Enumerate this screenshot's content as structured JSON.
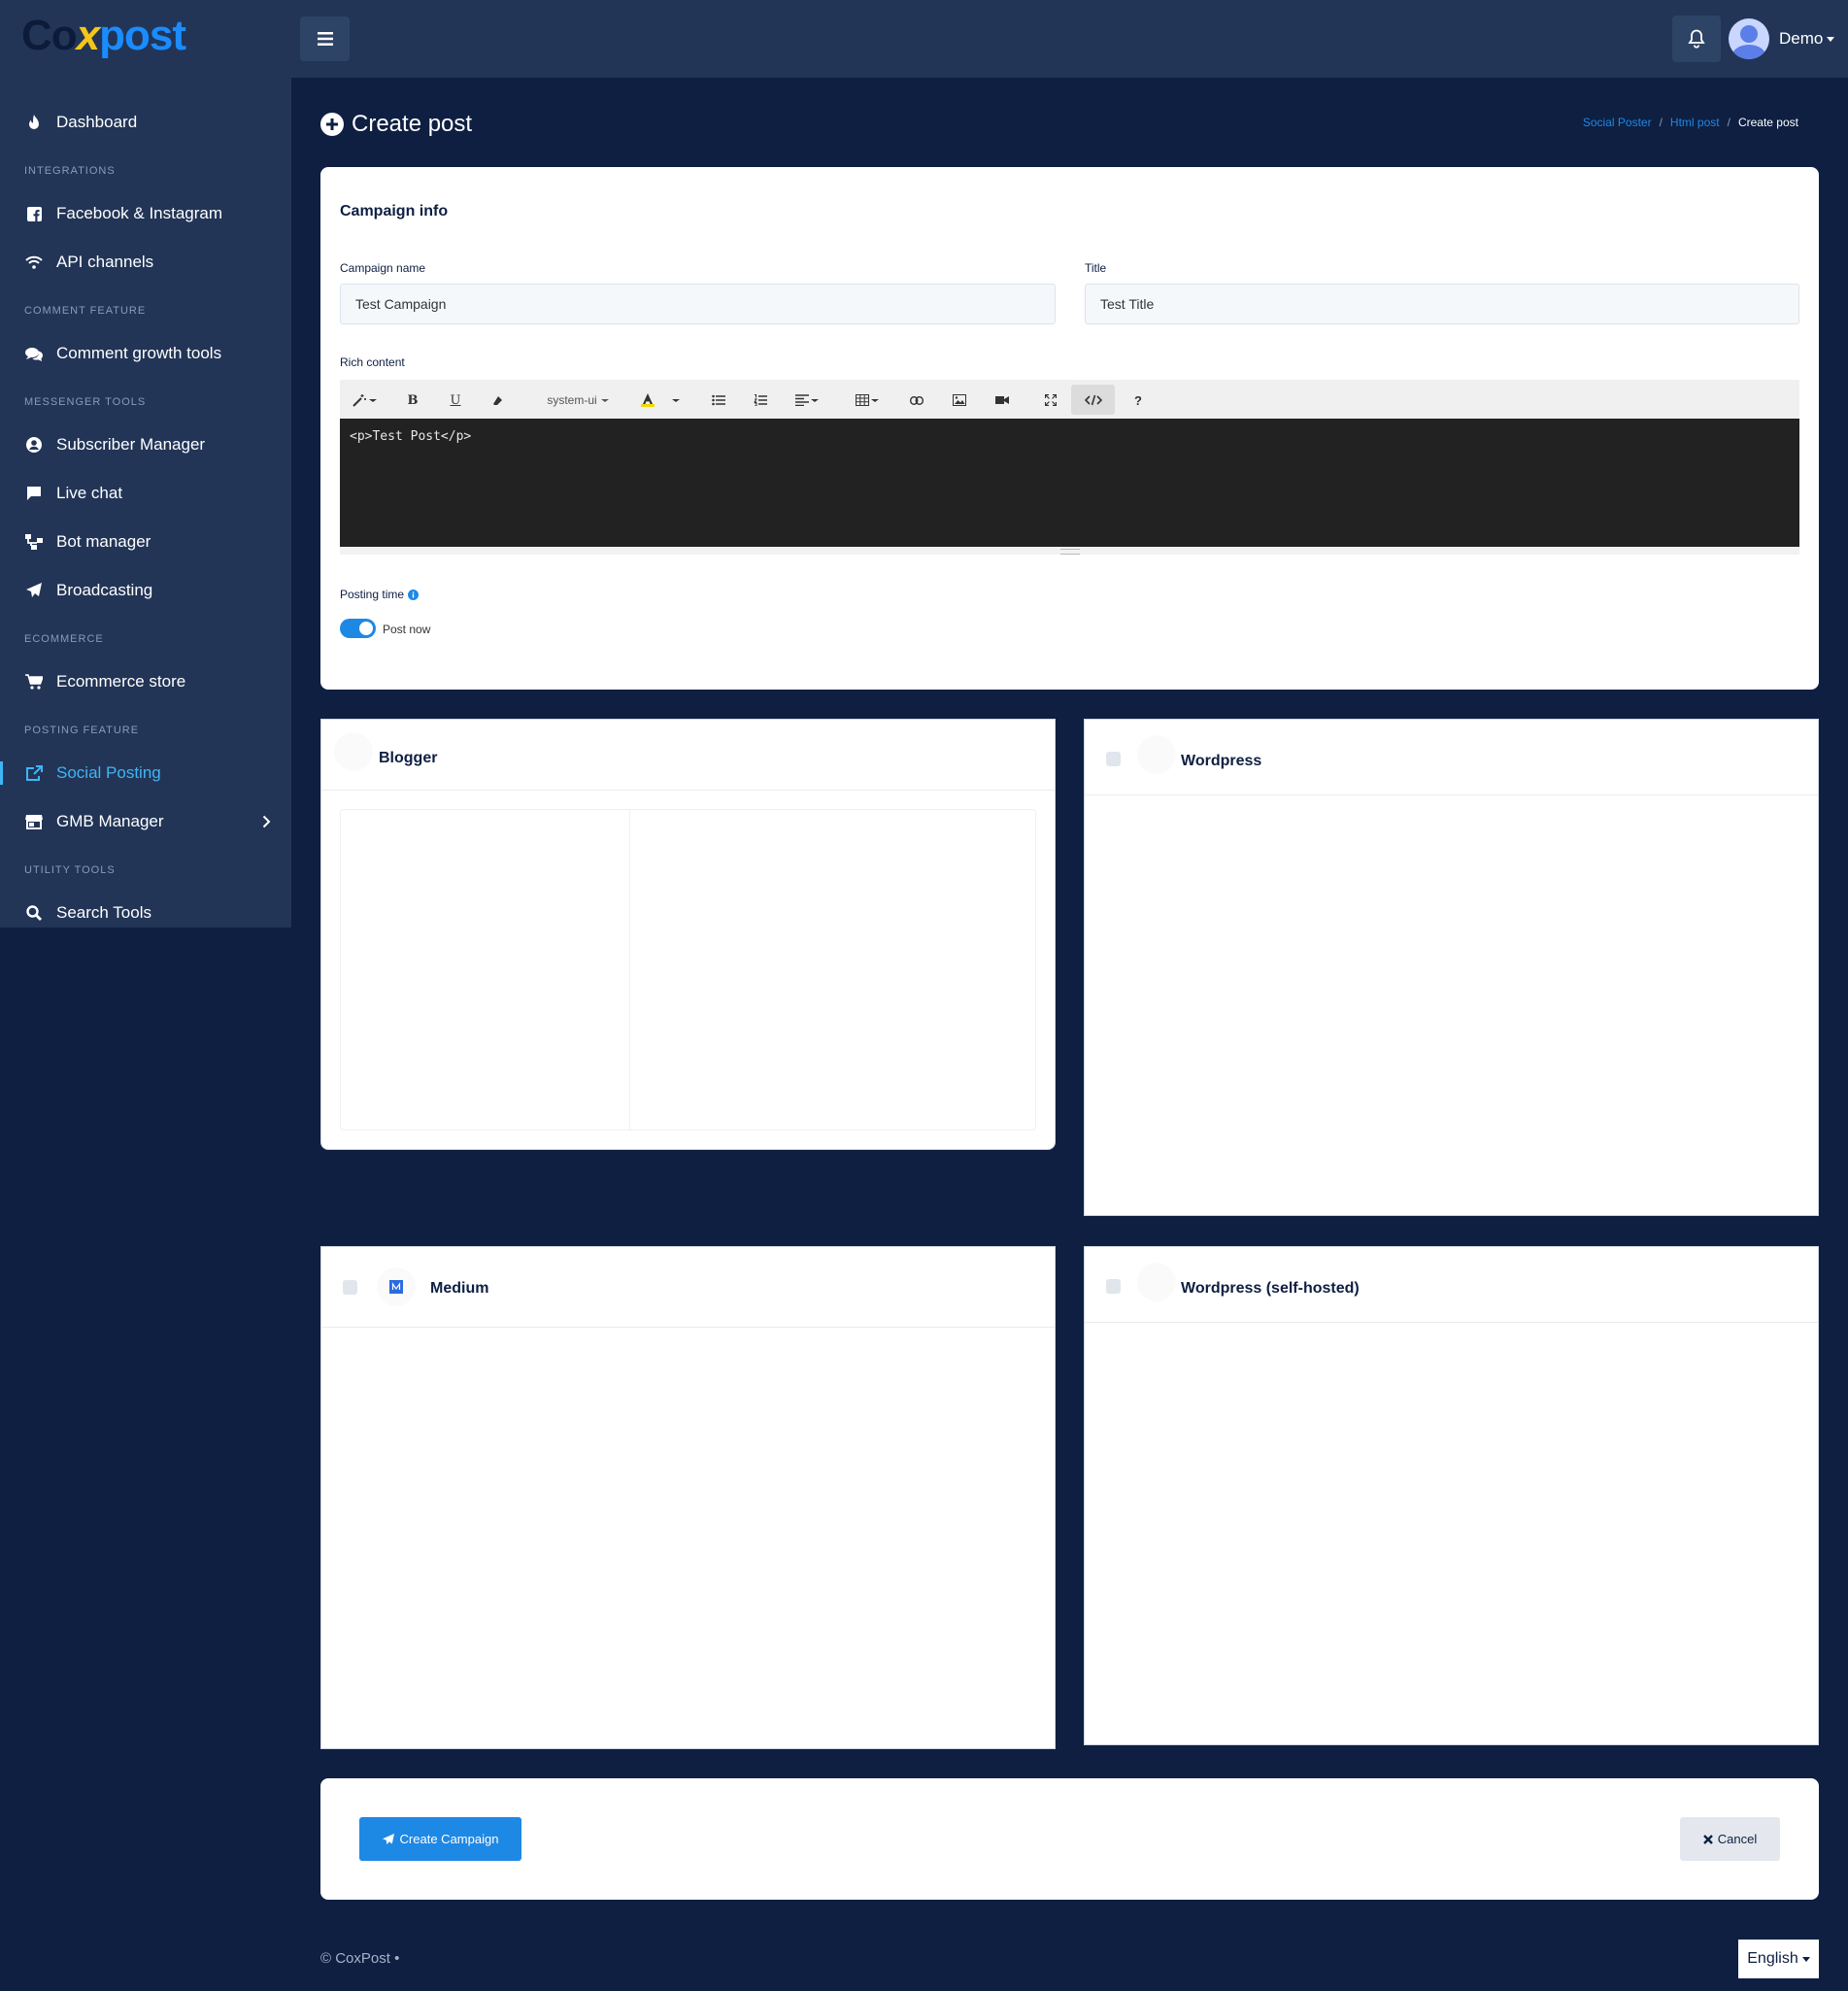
{
  "brand": {
    "logo_part1": "Co",
    "logo_x": "x",
    "logo_part2": "post"
  },
  "topbar": {
    "user_name": "Demo"
  },
  "sidebar": {
    "dashboard": "Dashboard",
    "integrations_head": "INTEGRATIONS",
    "facebook": "Facebook & Instagram",
    "api": "API channels",
    "comment_head": "COMMENT FEATURE",
    "comment_tools": "Comment growth tools",
    "messenger_head": "MESSENGER TOOLS",
    "subscriber": "Subscriber Manager",
    "livechat": "Live chat",
    "bot": "Bot manager",
    "broadcast": "Broadcasting",
    "ecommerce_head": "ECOMMERCE",
    "store": "Ecommerce store",
    "posting_head": "POSTING FEATURE",
    "social": "Social Posting",
    "gmb": "GMB Manager",
    "utility_head": "UTILITY TOOLS",
    "search": "Search Tools"
  },
  "page": {
    "title": "Create post"
  },
  "breadcrumb": {
    "item1": "Social Poster",
    "item2": "Html post",
    "current": "Create post",
    "sep": "/"
  },
  "campaign": {
    "card_title": "Campaign info",
    "name_label": "Campaign name",
    "name_value": "Test Campaign",
    "title_label": "Title",
    "title_value": "Test Title",
    "rich_label": "Rich content",
    "font_name": "system-ui",
    "code": "<p>Test Post</p>",
    "posting_label": "Posting time",
    "post_now": "Post now"
  },
  "panels": {
    "blogger": "Blogger",
    "wordpress": "Wordpress",
    "medium": "Medium",
    "wordpress_self": "Wordpress (self-hosted)"
  },
  "actions": {
    "create": "Create Campaign",
    "cancel": "Cancel"
  },
  "footer": {
    "copyright": "© CoxPost  •",
    "language": "English"
  },
  "colors": {
    "bg": "#0e1f42",
    "sidebar": "#223557",
    "accent": "#1e88e5",
    "active": "#3fb5f5"
  }
}
